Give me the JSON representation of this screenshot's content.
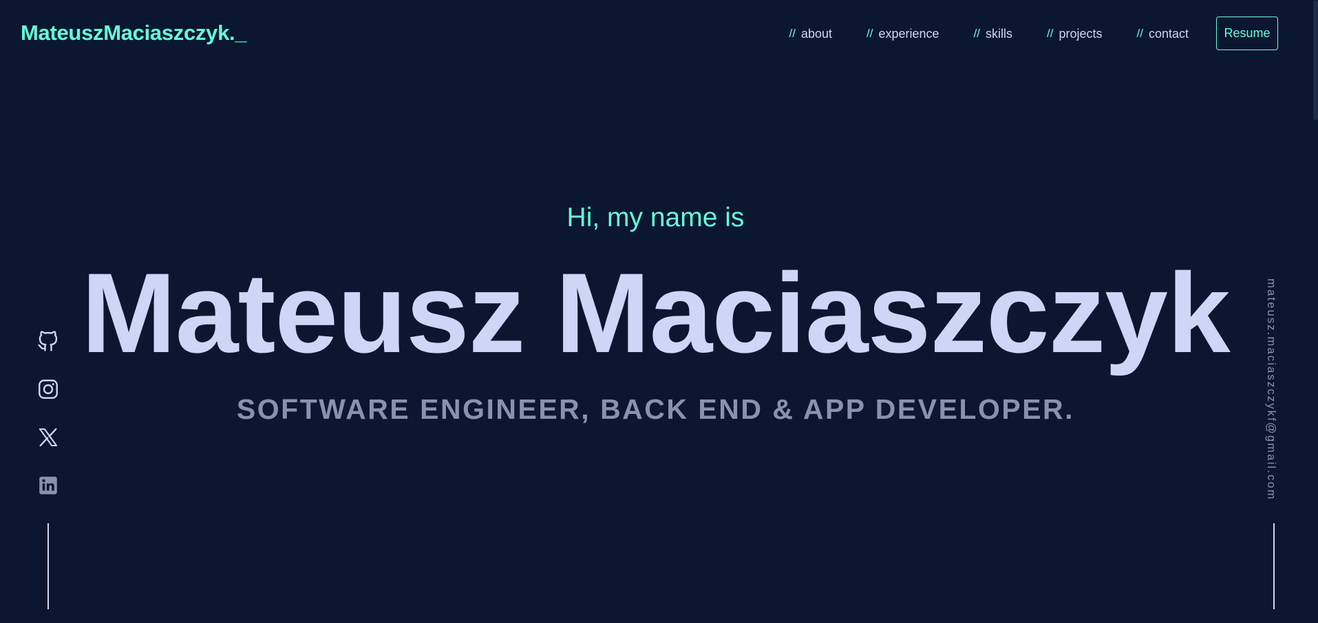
{
  "header": {
    "logo": "MateuszMaciaszczyk._",
    "nav_prefix": "//",
    "nav": [
      {
        "label": "about"
      },
      {
        "label": "experience"
      },
      {
        "label": "skills"
      },
      {
        "label": "projects"
      },
      {
        "label": "contact"
      }
    ],
    "resume_label": "Resume"
  },
  "hero": {
    "greeting": "Hi, my name is",
    "name": "Mateusz Maciaszczyk",
    "subtitle": "SOFTWARE ENGINEER, BACK END & APP DEVELOPER."
  },
  "social": {
    "icons": [
      "github-icon",
      "instagram-icon",
      "x-icon",
      "linkedin-icon"
    ]
  },
  "email": "mateusz.maciaszczykf@gmail.com",
  "colors": {
    "background": "#0b1730",
    "accent": "#64ffda",
    "light_text": "#ccd6f6",
    "muted_text": "#8892b0"
  }
}
